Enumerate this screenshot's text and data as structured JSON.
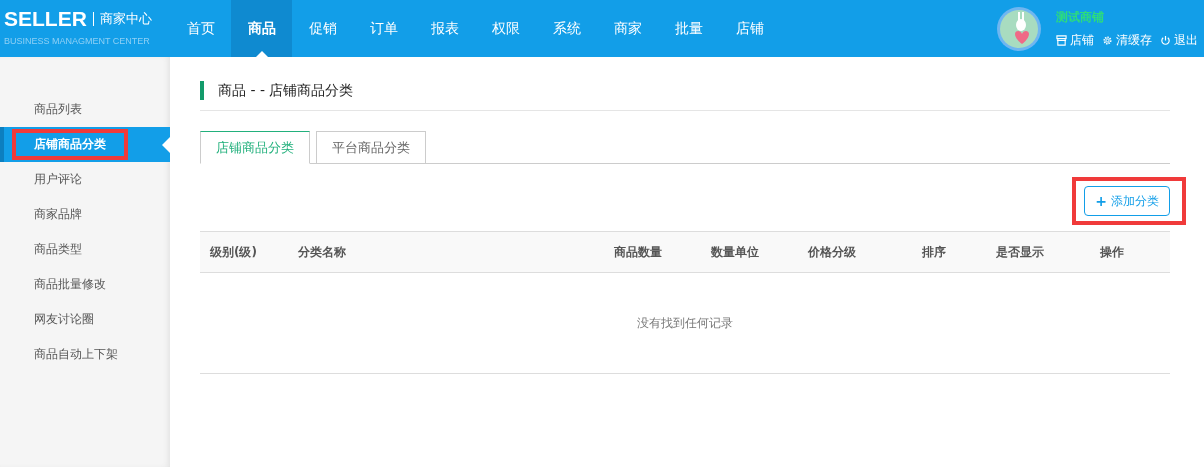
{
  "brand": {
    "logo": "SELLER",
    "title": "商家中心",
    "subtitle": "BUSINESS MANAGMENT CENTER"
  },
  "nav": [
    {
      "label": "首页",
      "selected": false
    },
    {
      "label": "商品",
      "selected": true
    },
    {
      "label": "促销",
      "selected": false
    },
    {
      "label": "订单",
      "selected": false
    },
    {
      "label": "报表",
      "selected": false
    },
    {
      "label": "权限",
      "selected": false
    },
    {
      "label": "系统",
      "selected": false
    },
    {
      "label": "商家",
      "selected": false
    },
    {
      "label": "批量",
      "selected": false
    },
    {
      "label": "店铺",
      "selected": false
    }
  ],
  "user": {
    "name": "测试商铺",
    "actions": [
      {
        "kind": "store",
        "label": "店铺"
      },
      {
        "kind": "settings",
        "label": "清缓存"
      },
      {
        "kind": "power",
        "label": "退出"
      }
    ]
  },
  "sidebar": {
    "items": [
      {
        "label": "商品列表",
        "selected": false,
        "highlighted": false
      },
      {
        "label": "店铺商品分类",
        "selected": true,
        "highlighted": true
      },
      {
        "label": "用户评论",
        "selected": false,
        "highlighted": false
      },
      {
        "label": "商家品牌",
        "selected": false,
        "highlighted": false
      },
      {
        "label": "商品类型",
        "selected": false,
        "highlighted": false
      },
      {
        "label": "商品批量修改",
        "selected": false,
        "highlighted": false
      },
      {
        "label": "网友讨论圈",
        "selected": false,
        "highlighted": false
      },
      {
        "label": "商品自动上下架",
        "selected": false,
        "highlighted": false
      }
    ]
  },
  "page_title": "商品 - - 店铺商品分类",
  "tabs": [
    {
      "label": "店铺商品分类",
      "selected": true
    },
    {
      "label": "平台商品分类",
      "selected": false
    }
  ],
  "add_button": {
    "icon": "+",
    "label": "添加分类",
    "highlighted": true
  },
  "table": {
    "columns": [
      "级别(级)",
      "分类名称",
      "商品数量",
      "数量单位",
      "价格分级",
      "排序",
      "是否显示",
      "操作"
    ],
    "empty_text": "没有找到任何记录"
  }
}
